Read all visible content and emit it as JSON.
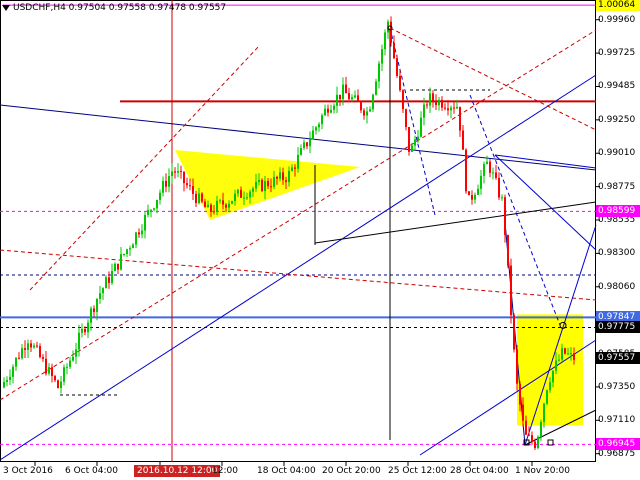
{
  "header": {
    "symbol_line": "USDCHF,H4  0.97504 0.97558 0.97478 0.97557"
  },
  "y_axis": {
    "ticks": [
      "0.99960",
      "0.99725",
      "0.99485",
      "0.99250",
      "0.99010",
      "0.98775",
      "0.98535",
      "0.98300",
      "0.98060",
      "0.97825",
      "0.97585",
      "0.97350",
      "0.97110",
      "0.96875"
    ],
    "tags": [
      {
        "label": "1.00064",
        "value": 1.00064,
        "bg": "#ffff00",
        "fg": "#000000"
      },
      {
        "label": "0.98599",
        "value": 0.98599,
        "bg": "#ff00ff",
        "fg": "#ffffff"
      },
      {
        "label": "0.97847",
        "value": 0.97847,
        "bg": "#4169e1",
        "fg": "#ffffff"
      },
      {
        "label": "0.97775",
        "value": 0.97775,
        "bg": "#000000",
        "fg": "#ffffff"
      },
      {
        "label": "0.97557",
        "value": 0.97557,
        "bg": "#000000",
        "fg": "#ffffff"
      },
      {
        "label": "0.96945",
        "value": 0.96945,
        "bg": "#ff00ff",
        "fg": "#ffffff"
      }
    ]
  },
  "x_axis": {
    "ticks": [
      "3 Oct 2016",
      "6 Oct 04:00",
      "2016.10.12 12:00",
      "18 Oct 04:00",
      "20 Oct 20:00",
      "25 Oct 12:00",
      "28 Oct 04:00",
      "1 Nov 20:00"
    ],
    "cursor_label": "2016.10.12 12:00",
    "extra_label": "12:00"
  },
  "chart_data": {
    "type": "candlestick",
    "symbol": "USDCHF",
    "timeframe": "H4",
    "ohlc_last": {
      "open": 0.97504,
      "high": 0.97558,
      "low": 0.97478,
      "close": 0.97557
    },
    "ylim": [
      0.9682,
      1.001
    ],
    "levels": {
      "resistance_top": 1.00064,
      "resistance_red": 0.9938,
      "magenta_upper": 0.98599,
      "blue_support": 0.97847,
      "black_dashed": 0.97775,
      "magenta_lower": 0.96945
    },
    "bullish_color": "#00c800",
    "bearish_color": "#ff0000",
    "highlight_color": "#ffff00"
  }
}
